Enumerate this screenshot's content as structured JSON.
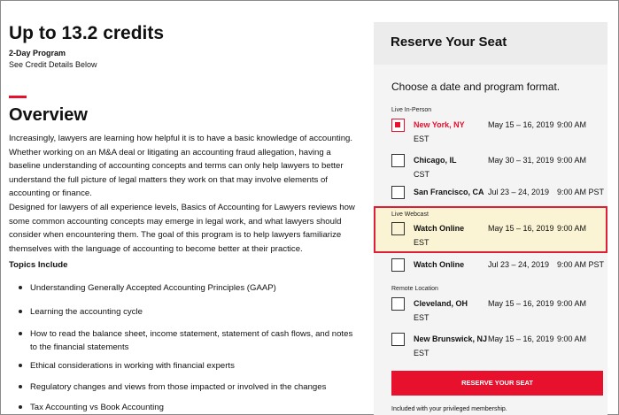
{
  "header": {
    "title": "Up to 13.2 credits",
    "program_type": "2-Day Program",
    "credit_details_link": "See Credit Details Below"
  },
  "overview": {
    "title": "Overview",
    "paragraph1": "Increasingly, lawyers are learning how helpful it is to have a basic knowledge of accounting. Whether working on an M&A deal or litigating an accounting fraud allegation, having a baseline understanding of accounting concepts and terms can only help lawyers to better understand the full picture of legal matters they work on that may involve elements of accounting or finance.",
    "paragraph2": "Designed for lawyers of all experience levels, Basics of Accounting for Lawyers reviews how some common accounting concepts may emerge in legal work, and what lawyers should consider when encountering them. The goal of this program is to help lawyers familiarize themselves with the language of accounting to become better at their practice.",
    "topics_heading": "Topics Include",
    "topics": [
      "Understanding Generally Accepted Accounting Principles (GAAP)",
      "Learning the accounting cycle",
      "How to read the balance sheet, income statement, statement of cash flows, and notes to the financial statements",
      "Ethical considerations in working with financial experts",
      "Regulatory changes and views from those impacted or involved in the changes",
      "Tax Accounting vs Book Accounting"
    ]
  },
  "reserve": {
    "title": "Reserve Your Seat",
    "intro": "Choose a date and program format.",
    "groups": {
      "live_in_person": "Live In-Person",
      "live_webcast": "Live Webcast",
      "remote_location": "Remote Location"
    },
    "options": [
      {
        "location": "New York, NY",
        "tz": "EST",
        "dates": "May 15 – 16, 2019",
        "time": "9:00 AM",
        "checked": true
      },
      {
        "location": "Chicago, IL",
        "tz": "CST",
        "dates": "May 30 – 31, 2019",
        "time": "9:00 AM",
        "checked": false
      },
      {
        "location": "San Francisco, CA",
        "tz": "",
        "dates": "Jul 23 – 24, 2019",
        "time": "9:00 AM PST",
        "checked": false
      },
      {
        "location": "Watch Online",
        "tz": "EST",
        "dates": "May 15 – 16, 2019",
        "time": "9:00 AM",
        "checked": false
      },
      {
        "location": "Watch Online",
        "tz": "",
        "dates": "Jul 23 – 24, 2019",
        "time": "9:00 AM PST",
        "checked": false
      },
      {
        "location": "Cleveland, OH",
        "tz": "EST",
        "dates": "May 15 – 16, 2019",
        "time": "9:00 AM",
        "checked": false
      },
      {
        "location": "New Brunswick, NJ",
        "tz": "EST",
        "dates": "May 15 – 16, 2019",
        "time": "9:00 AM",
        "checked": false
      }
    ],
    "button_label": "RESERVE YOUR SEAT",
    "membership_note": "Included with your privileged membership."
  },
  "colors": {
    "accent": "#e8112d",
    "highlight_fill": "#fbf4d4",
    "highlight_border": "#dd1f3a",
    "panel_bg": "#f4f4f4"
  }
}
